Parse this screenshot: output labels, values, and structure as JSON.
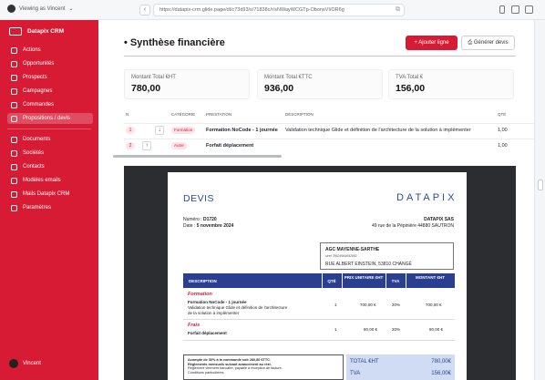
{
  "browser": {
    "viewer": "Viewing as Vincent",
    "url": "https://datapix-crm.glide.page/dl/c73d93/s/71838c/r/sNWayWCGTp-ObonsVI/OR6g"
  },
  "sidebar": {
    "brand": "Datapix CRM",
    "items": [
      {
        "label": "Actions"
      },
      {
        "label": "Opportunités"
      },
      {
        "label": "Prospects"
      },
      {
        "label": "Campagnes"
      },
      {
        "label": "Commandes"
      },
      {
        "label": "Propositions / devis"
      },
      {
        "label": "Documents"
      },
      {
        "label": "Sociétés"
      },
      {
        "label": "Contacts"
      },
      {
        "label": "Modèles emails"
      },
      {
        "label": "Mails Datapix CRM"
      },
      {
        "label": "Paramètres"
      }
    ],
    "user": "Vincent"
  },
  "header": {
    "title": "• Synthèse financière",
    "add_line": "+ Ajouter ligne",
    "generate": "Générer devis"
  },
  "kpis": [
    {
      "label": "Montant Total €HT",
      "value": "780,00"
    },
    {
      "label": "Montant Total €TTC",
      "value": "936,00"
    },
    {
      "label": "TVA Total €",
      "value": "156,00"
    }
  ],
  "lines_table": {
    "headers": {
      "n": "N",
      "cat": "CATÉGORIE",
      "prest": "PRESTATION",
      "desc": "DESCRIPTION",
      "qty": "QTÉ"
    },
    "rows": [
      {
        "n": "1",
        "arrow": "↓",
        "cat": "Formation",
        "prest": "Formation NoCode - 1 journée",
        "desc": "Validation technique Glide et définition de l'architecture de la solution à implémenter",
        "qty": "1,00"
      },
      {
        "n": "2",
        "arrow": "↑",
        "cat": "Autre",
        "prest": "Forfait déplacement",
        "desc": "",
        "qty": "1,00"
      }
    ]
  },
  "doc": {
    "title": "DEVIS",
    "logo": "DATAPIX",
    "numero_label": "Numéro : ",
    "numero": "D1720",
    "date_label": "Date : ",
    "date": "5 novembre 2024",
    "company": "DATAPIX SAS",
    "company_addr": "49 rue de la Pépinière 44880 SAUTRON",
    "client_name": "AGC MAYENNE-SARTHE",
    "client_siret": "siret 78624944692882",
    "client_addr": "RUE ALBERT EINSTEIN, 53810 CHANGÉ",
    "table_headers": {
      "desc": "DESCRIPTION",
      "qty": "QTÉ",
      "pu": "PRIX UNITAIRE €HT",
      "tva": "TVA",
      "amount": "MONTANT €HT"
    },
    "rows": [
      {
        "category": "Formation",
        "title": "Formation NoCode - 1 journée",
        "desc1": "Validation technique Glide et définition de l'architecture",
        "desc2": "de la solution à implémenter",
        "qty": "1",
        "pu": "700,00 €",
        "tva": "20%",
        "amount": "700,00 €"
      },
      {
        "category": "Frais",
        "title": "Forfait déplacement",
        "qty": "1",
        "pu": "80,00 €",
        "tva": "20%",
        "amount": "80,00 €"
      }
    ],
    "terms": [
      "Acompte de 30% à la commande soit 280,80 €TTC.",
      "Règlements mensuels suivant avancement au réel.",
      "Règlement virement bancaire, payable à réception de facture.",
      "Conditions particulières"
    ],
    "totals": [
      {
        "label": "TOTAL €HT",
        "value": "780,00€"
      },
      {
        "label": "TVA",
        "value": "156,00€"
      }
    ]
  }
}
